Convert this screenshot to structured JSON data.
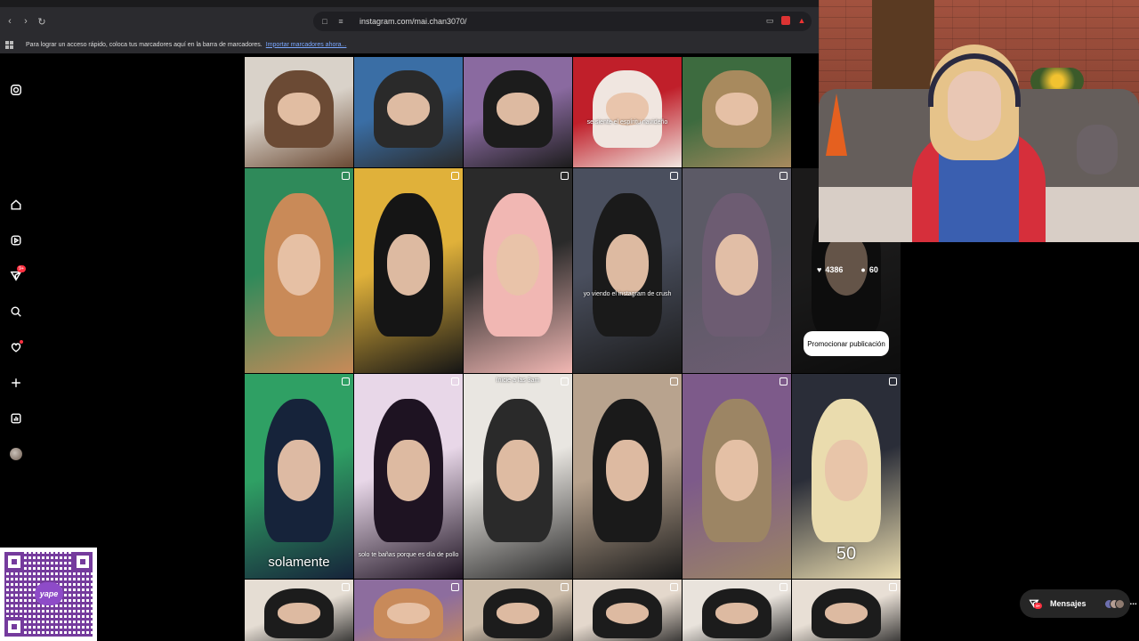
{
  "browser": {
    "url": "instagram.com/mai.chan3070/",
    "bookmarks_text": "Para lograr un acceso rápido, coloca tus marcadores aquí en la barra de marcadores.",
    "bookmarks_link": "Importar marcadores ahora..."
  },
  "sidebar": {
    "items": [
      {
        "name": "instagram-logo-icon"
      },
      {
        "name": "home-icon"
      },
      {
        "name": "reels-icon"
      },
      {
        "name": "messages-icon",
        "badge": "9+"
      },
      {
        "name": "search-icon"
      },
      {
        "name": "notifications-heart-icon"
      },
      {
        "name": "create-plus-icon"
      },
      {
        "name": "dashboard-icon"
      },
      {
        "name": "profile-avatar"
      }
    ]
  },
  "grid": {
    "tiles": [
      {
        "caption": "",
        "small_caption": "",
        "colors": [
          "#d9d2c9",
          "#6b4a34"
        ]
      },
      {
        "caption": "",
        "small_caption": "",
        "colors": [
          "#3a6ea5",
          "#2a2a2a"
        ]
      },
      {
        "caption": "",
        "small_caption": "",
        "colors": [
          "#8a6aa0",
          "#1c1c1c"
        ]
      },
      {
        "caption": "",
        "small_caption": "se siente el espíritu navideño",
        "colors": [
          "#c01f2a",
          "#f0e6e0"
        ]
      },
      {
        "caption": "",
        "small_caption": "",
        "colors": [
          "#3d6b3f",
          "#a88a5e"
        ]
      },
      {
        "caption": "",
        "small_caption": "",
        "colors": [
          "#2f8a5a",
          "#c98a58"
        ]
      },
      {
        "caption": "",
        "small_caption": "",
        "colors": [
          "#e0b13a",
          "#151515"
        ]
      },
      {
        "caption": "",
        "small_caption": "",
        "colors": [
          "#2a2a2a",
          "#f1b7b3"
        ]
      },
      {
        "caption": "",
        "small_caption": "yo viendo el instagram de crush",
        "colors": [
          "#4a4f5e",
          "#1a1a1a"
        ]
      },
      {
        "caption": "",
        "small_caption": "",
        "colors": [
          "#5c5a66",
          "#6d5c72"
        ]
      },
      {
        "caption": "",
        "small_caption": "",
        "colors": [
          "#3c3b3b",
          "#1d1d1d"
        ]
      },
      {
        "caption": "solamente",
        "small_caption": "",
        "colors": [
          "#2fa064",
          "#16233a"
        ]
      },
      {
        "caption": "",
        "small_caption": "solo te bañas porque es día de pollo",
        "colors": [
          "#e8d7e8",
          "#1e1322"
        ]
      },
      {
        "caption": "",
        "small_caption": "Inicie a las 3am",
        "colors": [
          "#e9e6e1",
          "#2a2a2a"
        ]
      },
      {
        "caption": "",
        "small_caption": "",
        "colors": [
          "#b8a38e",
          "#1a1a1a"
        ]
      },
      {
        "caption": "",
        "small_caption": "",
        "colors": [
          "#7d5a8a",
          "#9c8564"
        ]
      },
      {
        "caption": "50",
        "small_caption": "",
        "colors": [
          "#2a2d38",
          "#eadcae"
        ]
      },
      {
        "caption": "",
        "small_caption": "",
        "colors": [
          "#e5ddd3",
          "#1c1c1c"
        ]
      },
      {
        "caption": "",
        "small_caption": "",
        "colors": [
          "#8d6d9e",
          "#c88a5a"
        ]
      },
      {
        "caption": "",
        "small_caption": "",
        "colors": [
          "#cbbba8",
          "#1c1c1c"
        ]
      },
      {
        "caption": "",
        "small_caption": "",
        "colors": [
          "#e4d8cc",
          "#1c1c1c"
        ]
      },
      {
        "caption": "",
        "small_caption": "",
        "colors": [
          "#e9e3dc",
          "#1c1c1c"
        ]
      },
      {
        "caption": "",
        "small_caption": "",
        "colors": [
          "#e8dfd5",
          "#1c1c1c"
        ]
      }
    ]
  },
  "hover": {
    "likes": "4386",
    "comments": "60",
    "promote_label": "Promocionar publicación"
  },
  "qr": {
    "logo_text": "yape"
  },
  "messages": {
    "label": "Mensajes",
    "badge": "9+"
  },
  "colors": {
    "notification_red": "#ff3040",
    "background": "#000000"
  }
}
